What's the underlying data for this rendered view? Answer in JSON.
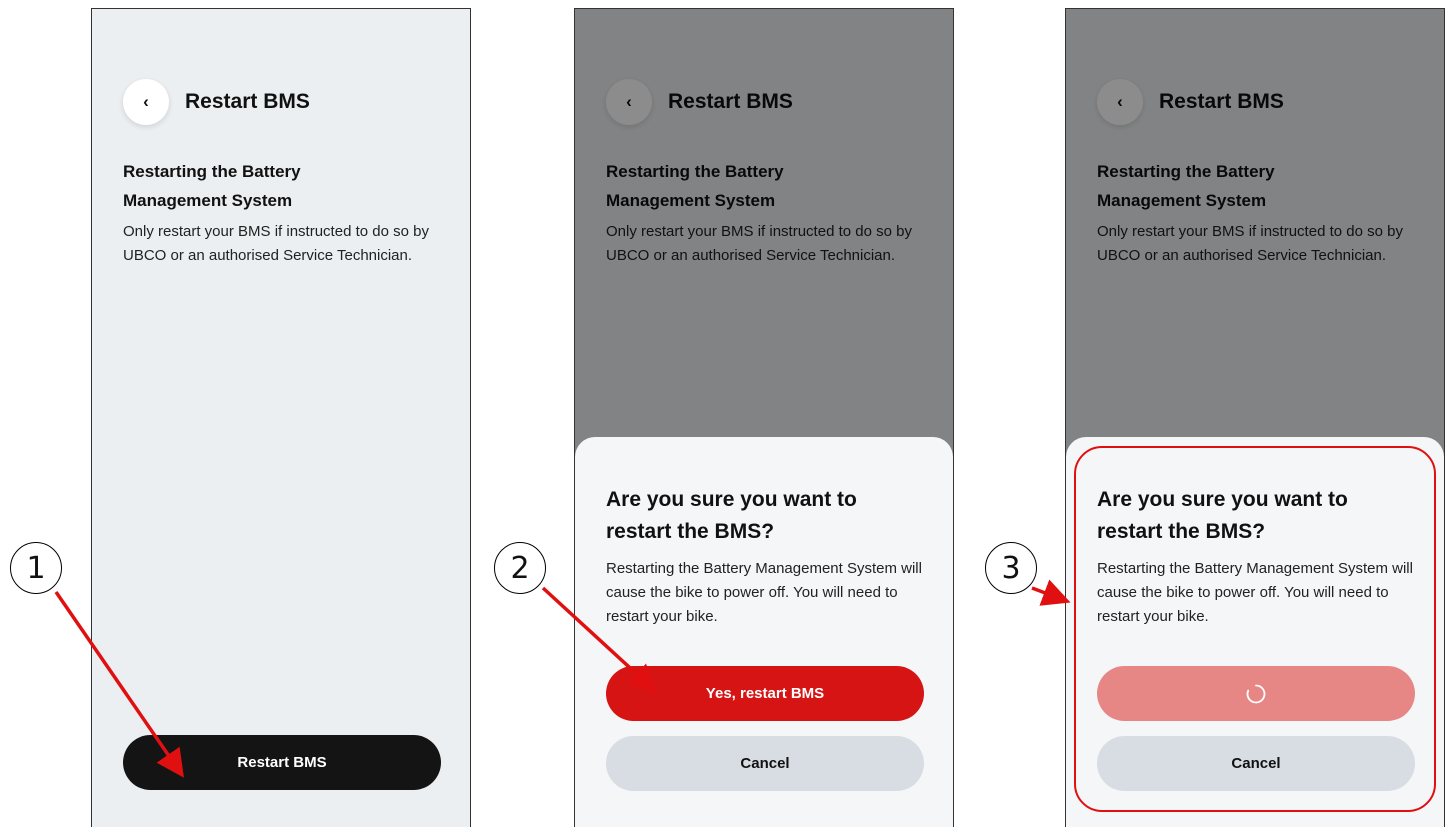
{
  "screens": [
    {
      "header_title": "Restart BMS",
      "back_icon": "chevron-left-icon",
      "heading": "Restarting the Battery Management System",
      "description": "Only restart your BMS if instructed to do so by UBCO or an authorised Service Technician.",
      "primary_button": "Restart BMS"
    },
    {
      "header_title": "Restart BMS",
      "heading": "Restarting the Battery Management System",
      "description": "Only restart your BMS if instructed to do so by UBCO or an authorised Service Technician.",
      "dialog": {
        "title": "Are you sure you want to restart the BMS?",
        "body": "Restarting the Battery Management System will cause the bike to power off. You will need to restart your bike.",
        "confirm_label": "Yes, restart BMS",
        "cancel_label": "Cancel"
      }
    },
    {
      "header_title": "Restart BMS",
      "heading": "Restarting the Battery Management System",
      "description": "Only restart your BMS if instructed to do so by UBCO or an authorised Service Technician.",
      "dialog": {
        "title": "Are you sure you want to restart the BMS?",
        "body": "Restarting the Battery Management System will cause the bike to power off. You will need to restart your bike.",
        "confirm_state": "loading",
        "cancel_label": "Cancel"
      }
    }
  ],
  "annotations": {
    "steps": [
      "1",
      "2",
      "3"
    ],
    "color": "#e01010"
  },
  "colors": {
    "background": "#eceff2",
    "primary_button": "#141414",
    "confirm_button": "#d71414",
    "confirm_loading": "#e68786",
    "cancel_button": "#d8dde3"
  }
}
